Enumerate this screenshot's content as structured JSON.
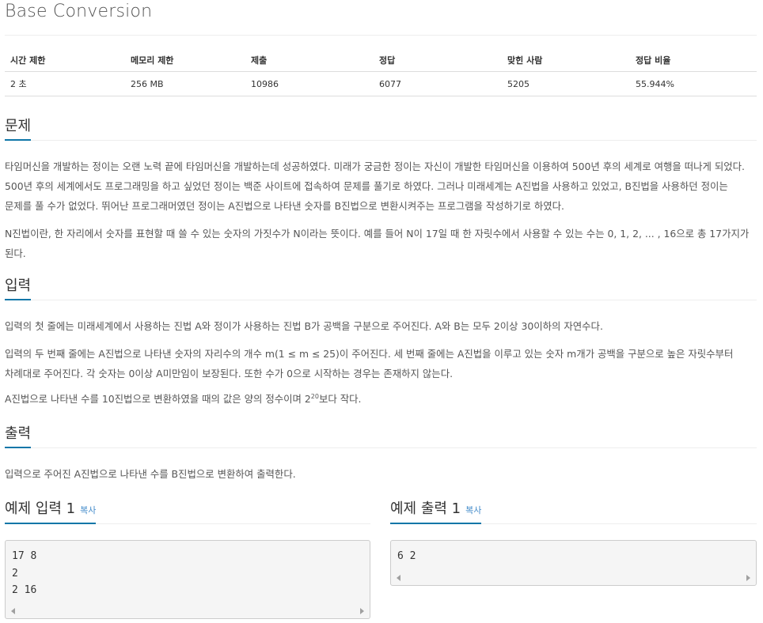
{
  "problem": {
    "title": "Base Conversion"
  },
  "info_table": {
    "headers": [
      "시간 제한",
      "메모리 제한",
      "제출",
      "정답",
      "맞힌 사람",
      "정답 비율"
    ],
    "values": [
      "2 초",
      "256 MB",
      "10986",
      "6077",
      "5205",
      "55.944%"
    ]
  },
  "sections": {
    "problem": {
      "heading": "문제",
      "p1": "타임머신을 개발하는 정이는 오랜 노력 끝에 타임머신을 개발하는데 성공하였다. 미래가 궁금한 정이는 자신이 개발한 타임머신을 이용하여 500년 후의 세계로 여행을 떠나게 되었다. 500년 후의 세계에서도 프로그래밍을 하고 싶었던 정이는 백준 사이트에 접속하여 문제를 풀기로 하였다. 그러나 미래세계는 A진법을 사용하고 있었고, B진법을 사용하던 정이는 문제를 풀 수가 없었다. 뛰어난 프로그래머였던 정이는 A진법으로 나타낸 숫자를 B진법으로 변환시켜주는 프로그램을 작성하기로 하였다.",
      "p2": "N진법이란, 한 자리에서 숫자를 표현할 때 쓸 수 있는 숫자의 가짓수가 N이라는 뜻이다. 예를 들어 N이 17일 때 한 자릿수에서 사용할 수 있는 수는 0, 1, 2, ... , 16으로 총 17가지가 된다."
    },
    "input": {
      "heading": "입력",
      "p1": "입력의 첫 줄에는 미래세계에서 사용하는 진법 A와 정이가 사용하는 진법 B가 공백을 구분으로 주어진다. A와 B는 모두 2이상 30이하의 자연수다.",
      "p2": "입력의 두 번째 줄에는 A진법으로 나타낸 숫자의 자리수의 개수 m(1 ≤ m ≤ 25)이 주어진다. 세 번째 줄에는 A진법을 이루고 있는 숫자 m개가 공백을 구분으로 높은 자릿수부터 차례대로 주어진다. 각 숫자는 0이상 A미만임이 보장된다. 또한 수가 0으로 시작하는 경우는 존재하지 않는다.",
      "p3_before": "A진법으로 나타낸 수를 10진법으로 변환하였을 때의 값은 양의 정수이며 2",
      "p3_sup": "20",
      "p3_after": "보다 작다."
    },
    "output": {
      "heading": "출력",
      "p1": "입력으로 주어진 A진법으로 나타낸 수를 B진법으로 변환하여 출력한다."
    }
  },
  "examples": {
    "input": {
      "title": "예제 입력 1",
      "copy_label": "복사",
      "lines": [
        "17 8",
        "2",
        "2 16"
      ]
    },
    "output": {
      "title": "예제 출력 1",
      "copy_label": "복사",
      "lines": [
        "6 2"
      ]
    }
  },
  "colors": {
    "accent_rule": "#0e76a8",
    "link": "#428bca"
  }
}
